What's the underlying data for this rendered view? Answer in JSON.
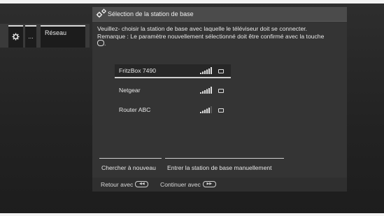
{
  "nav": {
    "dots_label": "...",
    "network_label": "Réseau"
  },
  "dialog": {
    "title": "Sélection de la station de base",
    "instruction_line1": "Veuillez- choisir la station de base avec laquelle le téléviseur doit se connecter.",
    "instruction_line2": "Remarque : Le paramètre nouvellement sélectionné doit être confirmé avec la touche",
    "stations": [
      {
        "name": "FritzBox 7490",
        "selected": true
      },
      {
        "name": "Netgear",
        "selected": false
      },
      {
        "name": "Router ABC",
        "selected": false
      }
    ],
    "search_again_label": "Chercher à nouveau",
    "manual_entry_label": "Entrer la station de base manuellement",
    "back_label": "Retour avec",
    "continue_label": "Continuer avec"
  },
  "icons": {
    "settings": "gear-icon",
    "dialog": "gears-icon",
    "signal": "signal-strength-icon",
    "lock": "lock-icon",
    "ok_key": "ok-key-icon",
    "back_key": "rewind-key-icon",
    "continue_key": "fast-forward-key-icon"
  }
}
